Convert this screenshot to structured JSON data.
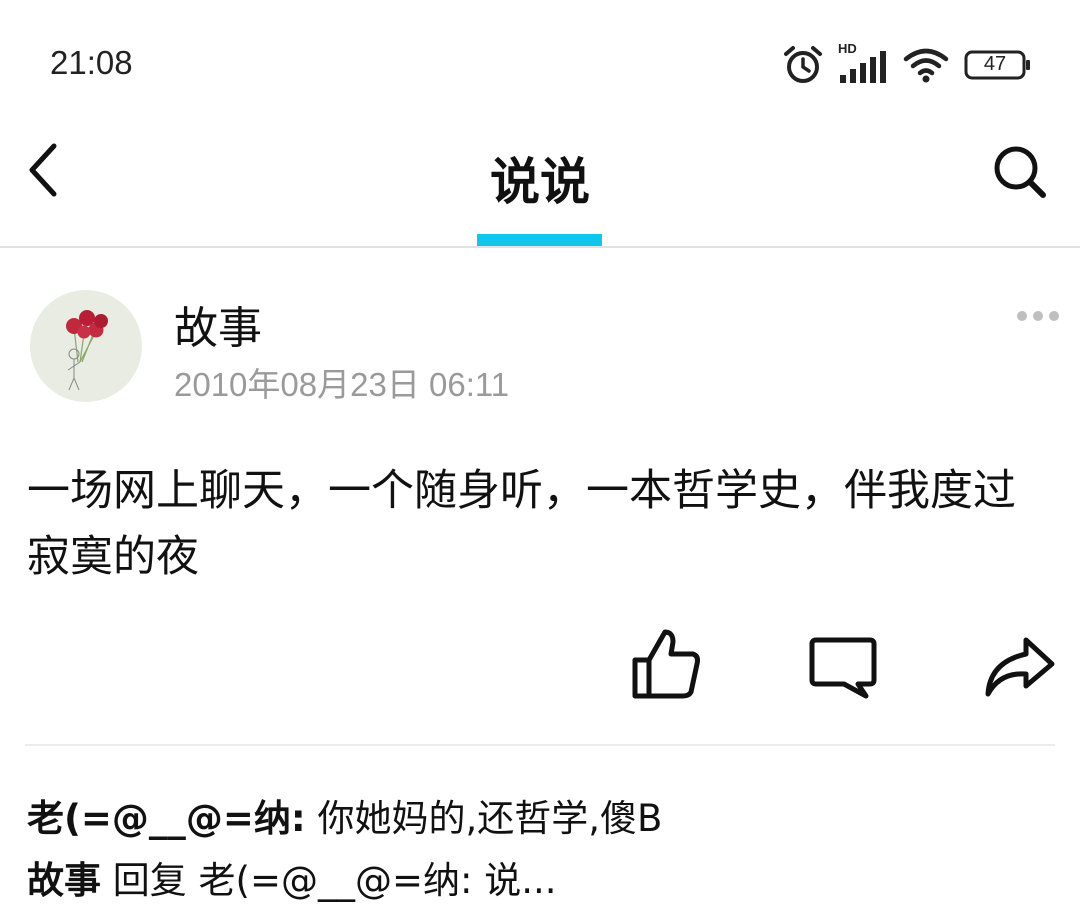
{
  "status_bar": {
    "time": "21:08",
    "network_badge": "HD",
    "battery_level": "47",
    "icons": [
      "alarm-icon",
      "signal-icon",
      "wifi-icon",
      "battery-icon"
    ]
  },
  "nav": {
    "title": "说说",
    "active_tab_color": "#11c6ec",
    "icons": [
      "back-chevron-icon",
      "search-icon"
    ]
  },
  "post": {
    "author": "故事",
    "date": "2010年08月23日 06:11",
    "content": "一场网上聊天，一个随身听，一本哲学史，伴我度过寂寞的夜",
    "actions": [
      "thumbs-up-icon",
      "comment-icon",
      "share-icon"
    ]
  },
  "comments": [
    {
      "author": "老(=@__@=纳",
      "separator": ":",
      "text": " 你她妈的,还哲学,傻B"
    },
    {
      "author": "故事",
      "separator": "回复",
      "text": " 老(=@__@=纳: 说..."
    }
  ]
}
